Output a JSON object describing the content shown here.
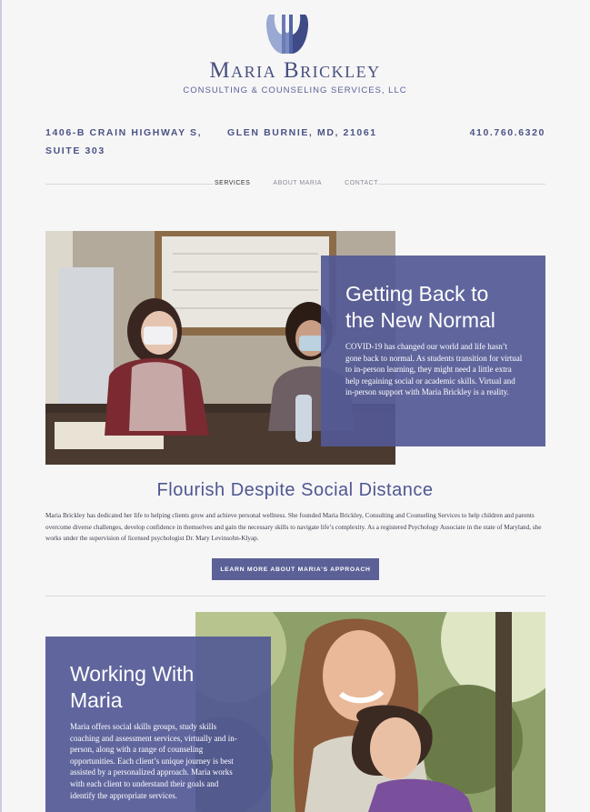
{
  "brand": {
    "name": "Maria Brickley",
    "subtitle": "Consulting & Counseling Services, LLC"
  },
  "contact": {
    "street_line1": "1406-B Crain Highway S,",
    "street_line2": "Suite 303",
    "city": "Glen Burnie, MD, 21061",
    "phone": "410.760.6320"
  },
  "nav": {
    "items": [
      "Services",
      "About Maria",
      "Contact"
    ],
    "active": "Services"
  },
  "hero1": {
    "title_line1": "Getting Back to",
    "title_line2": "the New Normal",
    "text": "COVID-19 has changed our world and life hasn’t gone back to normal. As students transition for virtual to in-person learning, they might need a little extra help regaining social or academic skills. Virtual and in-person support with Maria Brickley is a reality."
  },
  "flourish": {
    "title": "Flourish Despite Social Distance",
    "paragraph": "Maria Brickley has dedicated her life to helping clients grow and achieve personal wellness. She founded Maria Brickley, Consulting and Counseling Services to help children and parents overcome diverse challenges, develop confidence in themselves and gain the necessary skills to navigate life’s complexity. As a registered Psychology Associate in the state of Maryland, she works under the supervision of licensed psychologist Dr. Mary Levinsohn-Klyap.",
    "cta_label": "Learn more about Maria’s approach"
  },
  "hero2": {
    "title_line1": "Working With",
    "title_line2": "Maria",
    "text": "Maria offers social skills groups, study skills coaching and assessment services, virtually and in-person, along with a range of counseling opportunities. Each client’s unique journey is best assisted by a personalized approach. Maria works with each client to understand their goals and identify the appropriate services."
  },
  "colors": {
    "brand": "#48507f",
    "panel": "#535995",
    "button": "#5b6196",
    "background": "#f6f6f7"
  },
  "icons": {
    "logo": "stylized-head-logo-icon"
  }
}
